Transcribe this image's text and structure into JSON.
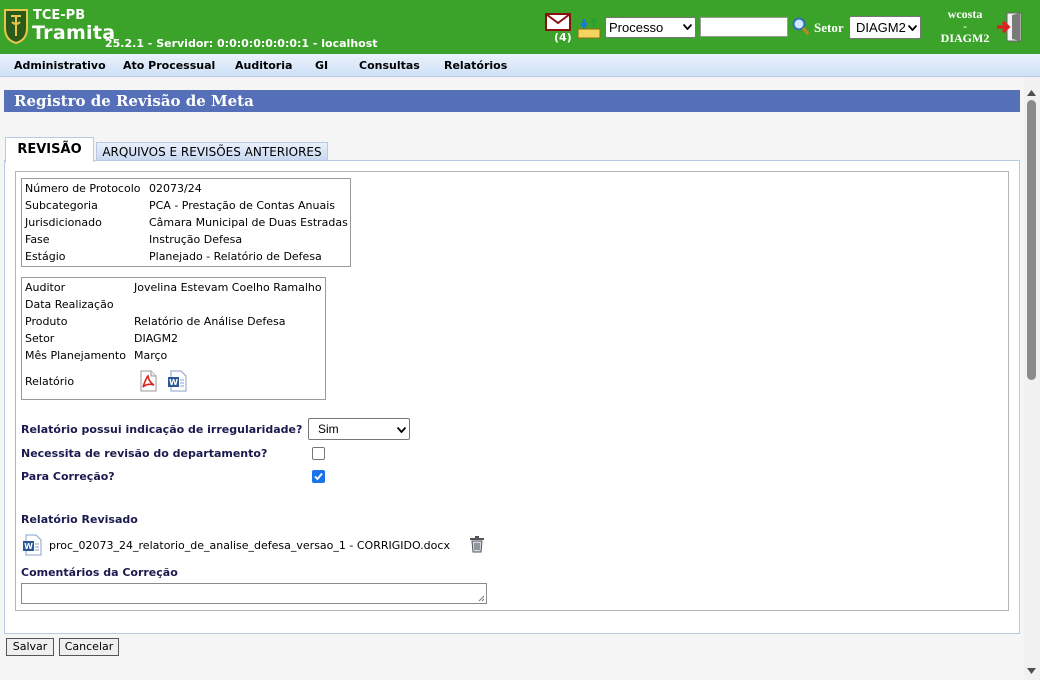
{
  "header": {
    "org": "TCE-PB",
    "app": "Tramita",
    "version_line": "25.2.1 - Servidor: 0:0:0:0:0:0:0:1 - localhost",
    "mail_count": "(4)",
    "search_type": "Processo",
    "search_value": "",
    "setor_label": "Setor",
    "setor_value": "DIAGM2",
    "user_name": "wcosta",
    "user_sep": "-",
    "user_setor": "DIAGM2"
  },
  "menu": [
    "Administrativo",
    "Ato Processual",
    "Auditoria",
    "GI",
    "Consultas",
    "Relatórios"
  ],
  "page_title": "Registro de Revisão de Meta",
  "tabs": [
    "REVISÃO",
    "ARQUIVOS E REVISÕES ANTERIORES"
  ],
  "protocol": {
    "labels": [
      "Número de Protocolo",
      "Subcategoria",
      "Jurisdicionado",
      "Fase",
      "Estágio"
    ],
    "values": [
      "02073/24",
      "PCA - Prestação de Contas Anuais",
      "Câmara Municipal de Duas Estradas",
      "Instrução Defesa",
      "Planejado - Relatório de Defesa"
    ]
  },
  "details": {
    "labels": [
      "Auditor",
      "Data Realização",
      "Produto",
      "Setor",
      "Mês Planejamento",
      "Relatório"
    ],
    "values": [
      "Jovelina Estevam Coelho Ramalho",
      "",
      "Relatório de Análise Defesa",
      "DIAGM2",
      "Março"
    ]
  },
  "questions": {
    "irregularidade_label": "Relatório possui indicação de irregularidade?",
    "irregularidade_value": "Sim",
    "revisao_label": "Necessita de revisão do departamento?",
    "revisao_checked": false,
    "correcao_label": "Para Correção?",
    "correcao_checked": true
  },
  "revised": {
    "section_label": "Relatório Revisado",
    "file_name": "proc_02073_24_relatorio_de_analise_defesa_versao_1 - CORRIGIDO.docx"
  },
  "comments": {
    "label": "Comentários da Correção",
    "value": ""
  },
  "buttons": {
    "save": "Salvar",
    "cancel": "Cancelar"
  },
  "colors": {
    "header_green": "#3ca32a",
    "title_blue": "#5570b8",
    "label_navy": "#1a1a4e"
  }
}
